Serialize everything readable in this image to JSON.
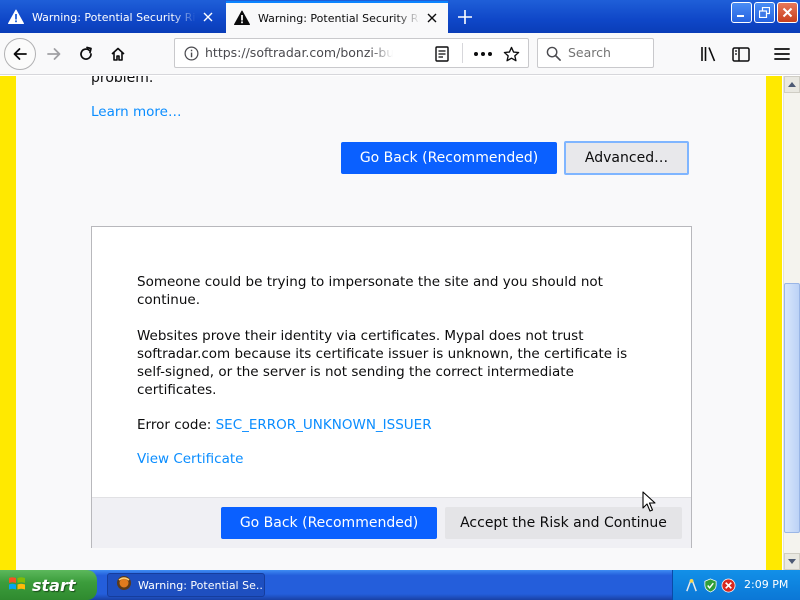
{
  "window": {
    "tabs": [
      {
        "title": "Warning: Potential Security Risk Ah",
        "active": false
      },
      {
        "title": "Warning: Potential Security Risk Ah",
        "active": true
      }
    ]
  },
  "toolbar": {
    "url": "https://softradar.com/bonzi-buddy",
    "search_placeholder": "Search"
  },
  "page": {
    "problem_tail": "problem.",
    "learn_more": "Learn more…",
    "go_back_label": "Go Back (Recommended)",
    "advanced_label": "Advanced…",
    "advanced_panel": {
      "paragraph1": "Someone could be trying to impersonate the site and you should not continue.",
      "paragraph2": "Websites prove their identity via certificates. Mypal does not trust softradar.com because its certificate issuer is unknown, the certificate is self-signed, or the server is not sending the correct intermediate certificates.",
      "error_code_label": "Error code:",
      "error_code": "SEC_ERROR_UNKNOWN_ISSUER",
      "view_certificate": "View Certificate",
      "go_back_label": "Go Back (Recommended)",
      "accept_label": "Accept the Risk and Continue"
    }
  },
  "taskbar": {
    "start_label": "start",
    "task_label": "Warning: Potential Se...",
    "clock": "2:09 PM"
  },
  "colors": {
    "accent_blue": "#0a60ff",
    "link_blue": "#0a8dff",
    "warning_stripe": "#ffe900",
    "xp_taskbar": "#245edb",
    "xp_start_green": "#3c9d3c"
  }
}
